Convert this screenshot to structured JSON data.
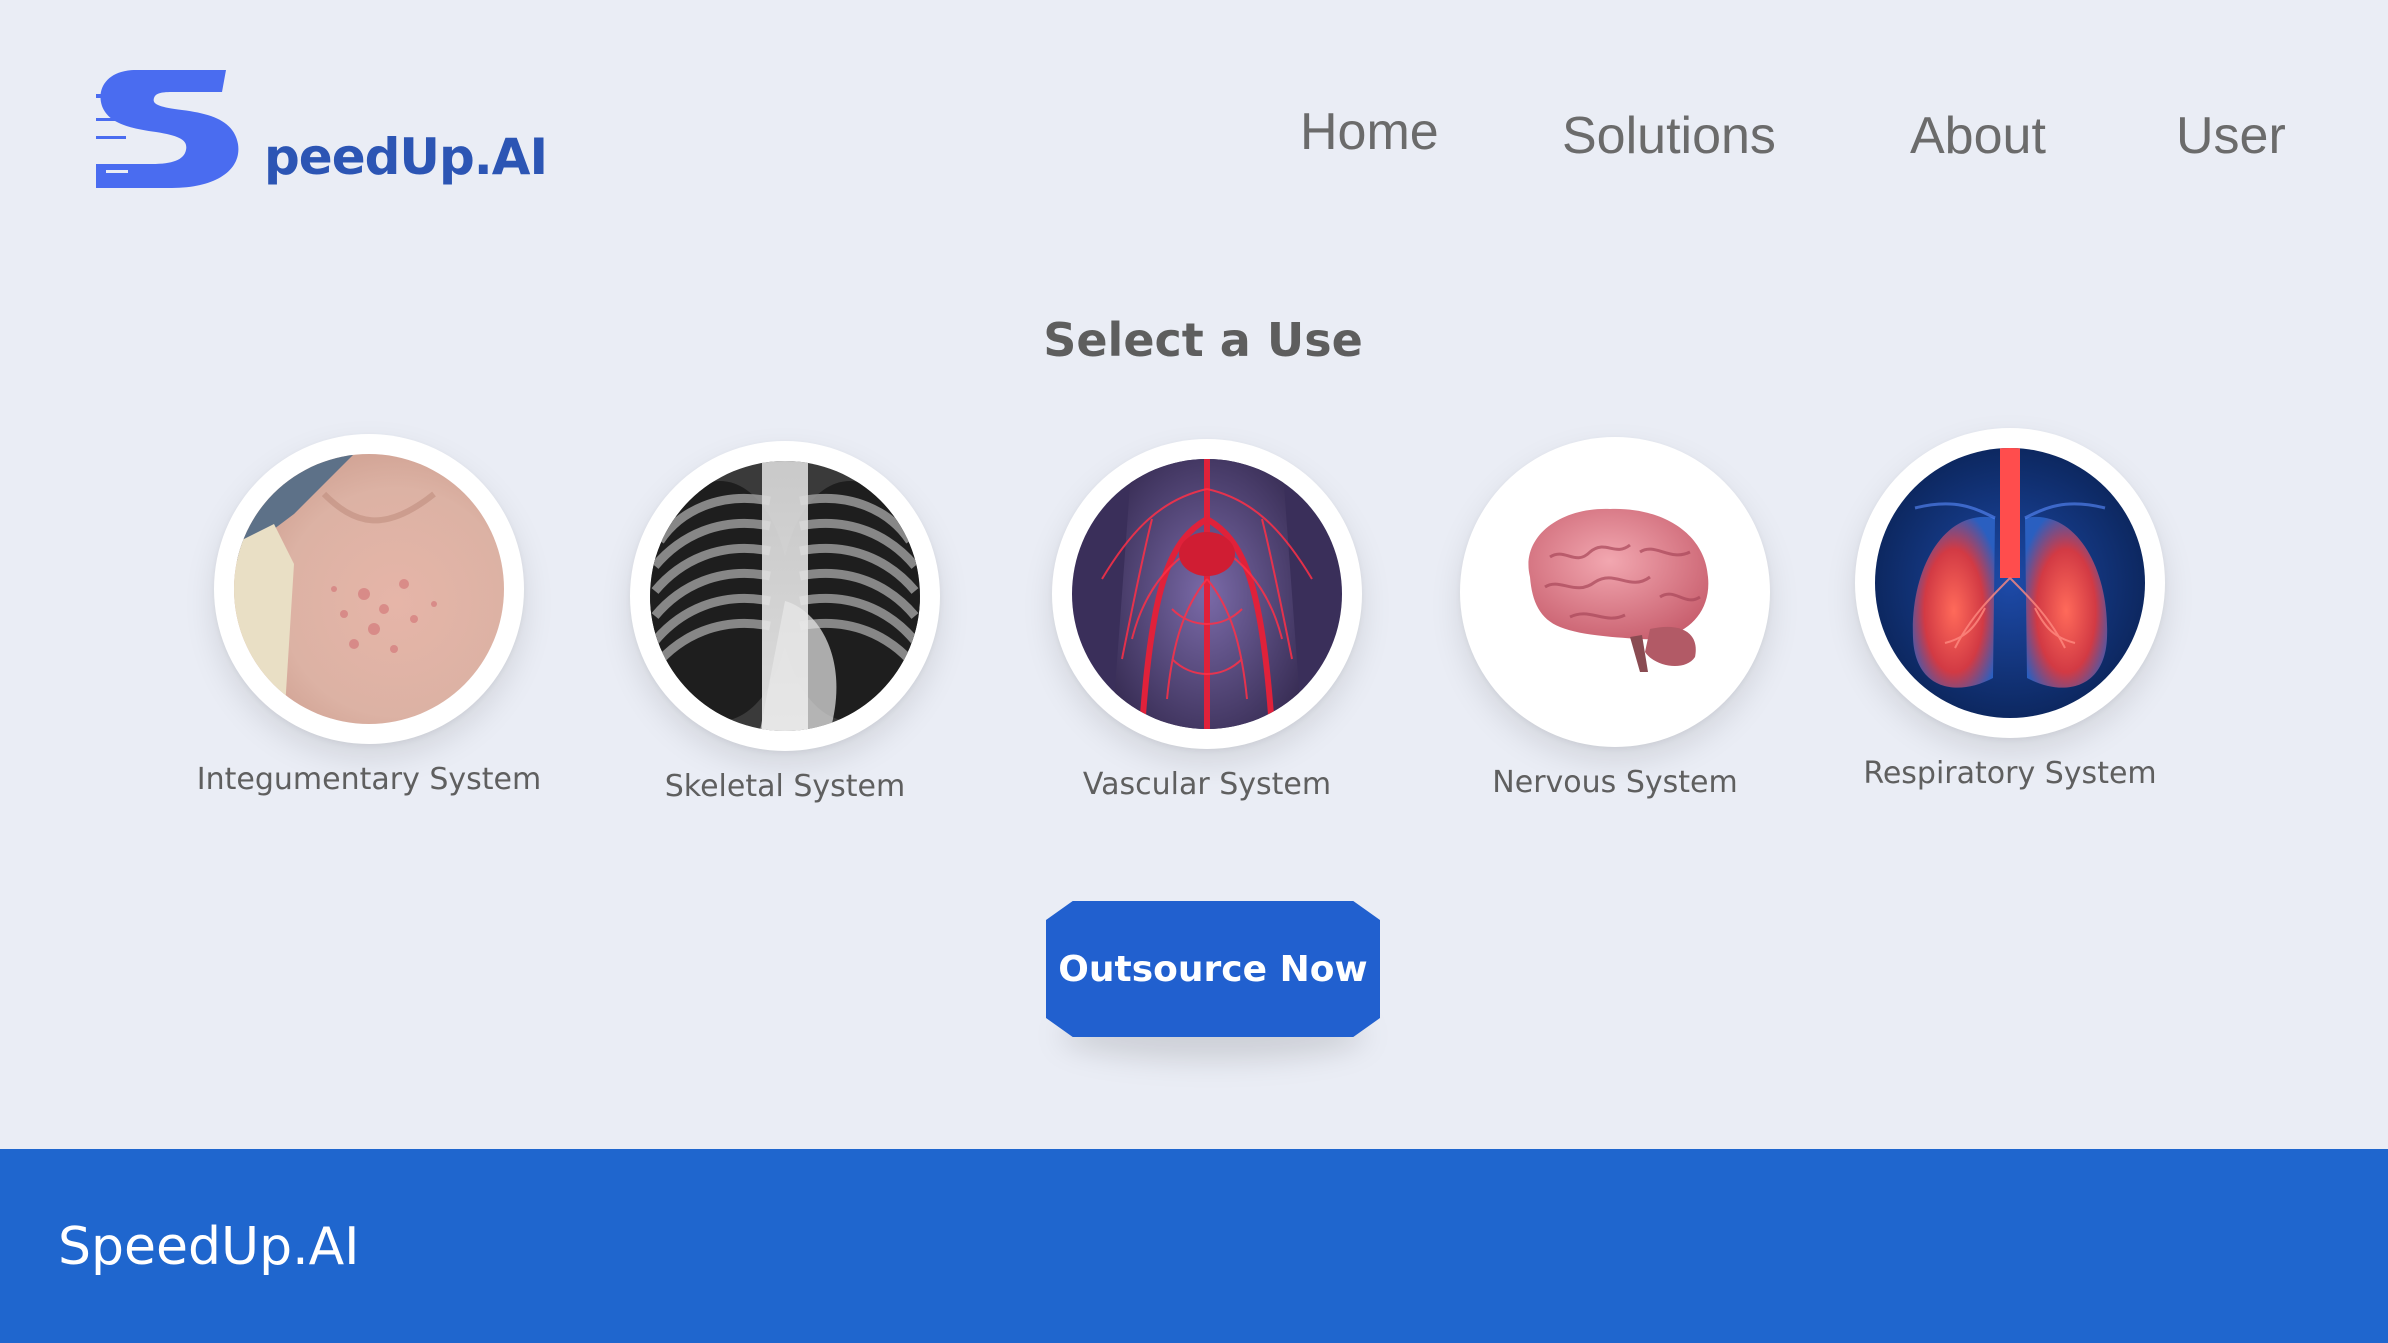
{
  "brand": {
    "logo_initial": "S",
    "logo_text": "peedUp.AI",
    "logo_color": "#4a6cf0"
  },
  "nav": {
    "items": [
      {
        "label": "Home"
      },
      {
        "label": "Solutions"
      },
      {
        "label": "About"
      },
      {
        "label": "User"
      }
    ]
  },
  "main": {
    "title": "Select a Use",
    "options": [
      {
        "label": "Integumentary System",
        "icon": "skin-rash-image"
      },
      {
        "label": "Skeletal System",
        "icon": "chest-xray-image"
      },
      {
        "label": "Vascular System",
        "icon": "blood-vessels-image"
      },
      {
        "label": "Nervous System",
        "icon": "brain-image"
      },
      {
        "label": "Respiratory System",
        "icon": "lungs-image"
      }
    ],
    "cta_label": "Outsource Now"
  },
  "footer": {
    "brand": "SpeedUp.AI"
  },
  "colors": {
    "background": "#eaedf5",
    "accent": "#2160cf",
    "footer": "#1f66ce",
    "nav_text": "#6b6b6b"
  }
}
